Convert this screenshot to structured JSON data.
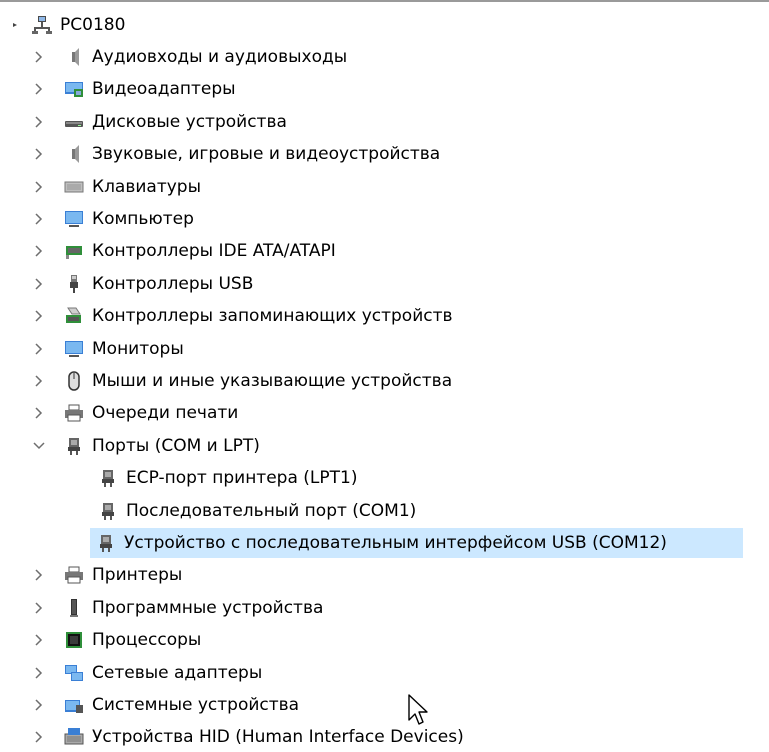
{
  "root": {
    "label": "PC0180",
    "icon": "computer-network-icon"
  },
  "categories": [
    {
      "label": "Аудиовходы и аудиовыходы",
      "icon": "speaker-icon",
      "expanded": false
    },
    {
      "label": "Видеоадаптеры",
      "icon": "display-adapter-icon",
      "expanded": false
    },
    {
      "label": "Дисковые устройства",
      "icon": "disk-drive-icon",
      "expanded": false
    },
    {
      "label": "Звуковые, игровые и видеоустройства",
      "icon": "speaker-icon",
      "expanded": false
    },
    {
      "label": "Клавиатуры",
      "icon": "keyboard-icon",
      "expanded": false
    },
    {
      "label": "Компьютер",
      "icon": "monitor-icon",
      "expanded": false
    },
    {
      "label": "Контроллеры IDE ATA/ATAPI",
      "icon": "ide-controller-icon",
      "expanded": false
    },
    {
      "label": "Контроллеры USB",
      "icon": "usb-icon",
      "expanded": false
    },
    {
      "label": "Контроллеры запоминающих устройств",
      "icon": "storage-controller-icon",
      "expanded": false
    },
    {
      "label": "Мониторы",
      "icon": "monitor-icon",
      "expanded": false
    },
    {
      "label": "Мыши и иные указывающие устройства",
      "icon": "mouse-icon",
      "expanded": false
    },
    {
      "label": "Очереди печати",
      "icon": "printer-icon",
      "expanded": false
    },
    {
      "label": "Порты (COM и LPT)",
      "icon": "port-icon",
      "expanded": true
    },
    {
      "label": "Принтеры",
      "icon": "printer-icon",
      "expanded": false
    },
    {
      "label": "Программные устройства",
      "icon": "software-device-icon",
      "expanded": false
    },
    {
      "label": "Процессоры",
      "icon": "processor-icon",
      "expanded": false
    },
    {
      "label": "Сетевые адаптеры",
      "icon": "network-adapter-icon",
      "expanded": false
    },
    {
      "label": "Системные устройства",
      "icon": "system-devices-icon",
      "expanded": false
    },
    {
      "label": "Устройства HID (Human Interface Devices)",
      "icon": "hid-icon",
      "expanded": false
    }
  ],
  "ports_children": [
    {
      "label": "ECP-порт принтера (LPT1)",
      "icon": "port-icon",
      "selected": false
    },
    {
      "label": "Последовательный порт (COM1)",
      "icon": "port-icon",
      "selected": false
    },
    {
      "label": "Устройство с последовательным интерфейсом USB (COM12)",
      "icon": "port-icon",
      "selected": true
    }
  ],
  "colors": {
    "selection": "#cce8ff",
    "chevron": "#6e6e6e"
  }
}
